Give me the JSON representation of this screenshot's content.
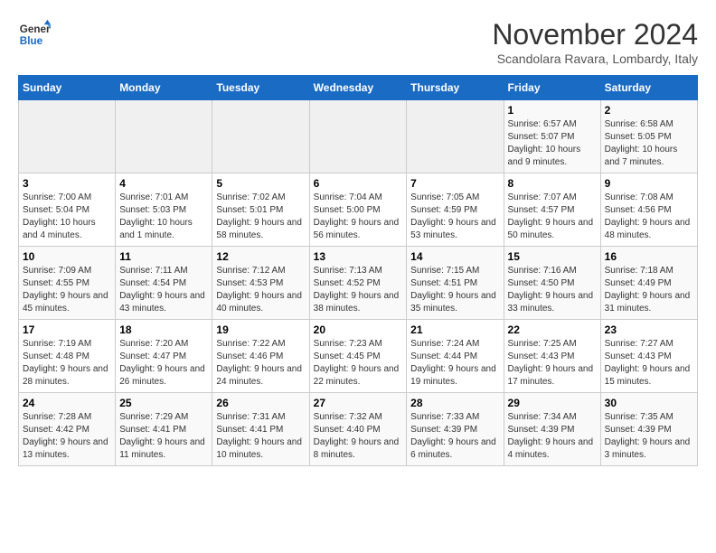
{
  "logo": {
    "line1": "General",
    "line2": "Blue"
  },
  "title": "November 2024",
  "subtitle": "Scandolara Ravara, Lombardy, Italy",
  "days_of_week": [
    "Sunday",
    "Monday",
    "Tuesday",
    "Wednesday",
    "Thursday",
    "Friday",
    "Saturday"
  ],
  "weeks": [
    [
      {
        "day": "",
        "info": ""
      },
      {
        "day": "",
        "info": ""
      },
      {
        "day": "",
        "info": ""
      },
      {
        "day": "",
        "info": ""
      },
      {
        "day": "",
        "info": ""
      },
      {
        "day": "1",
        "info": "Sunrise: 6:57 AM\nSunset: 5:07 PM\nDaylight: 10 hours and 9 minutes."
      },
      {
        "day": "2",
        "info": "Sunrise: 6:58 AM\nSunset: 5:05 PM\nDaylight: 10 hours and 7 minutes."
      }
    ],
    [
      {
        "day": "3",
        "info": "Sunrise: 7:00 AM\nSunset: 5:04 PM\nDaylight: 10 hours and 4 minutes."
      },
      {
        "day": "4",
        "info": "Sunrise: 7:01 AM\nSunset: 5:03 PM\nDaylight: 10 hours and 1 minute."
      },
      {
        "day": "5",
        "info": "Sunrise: 7:02 AM\nSunset: 5:01 PM\nDaylight: 9 hours and 58 minutes."
      },
      {
        "day": "6",
        "info": "Sunrise: 7:04 AM\nSunset: 5:00 PM\nDaylight: 9 hours and 56 minutes."
      },
      {
        "day": "7",
        "info": "Sunrise: 7:05 AM\nSunset: 4:59 PM\nDaylight: 9 hours and 53 minutes."
      },
      {
        "day": "8",
        "info": "Sunrise: 7:07 AM\nSunset: 4:57 PM\nDaylight: 9 hours and 50 minutes."
      },
      {
        "day": "9",
        "info": "Sunrise: 7:08 AM\nSunset: 4:56 PM\nDaylight: 9 hours and 48 minutes."
      }
    ],
    [
      {
        "day": "10",
        "info": "Sunrise: 7:09 AM\nSunset: 4:55 PM\nDaylight: 9 hours and 45 minutes."
      },
      {
        "day": "11",
        "info": "Sunrise: 7:11 AM\nSunset: 4:54 PM\nDaylight: 9 hours and 43 minutes."
      },
      {
        "day": "12",
        "info": "Sunrise: 7:12 AM\nSunset: 4:53 PM\nDaylight: 9 hours and 40 minutes."
      },
      {
        "day": "13",
        "info": "Sunrise: 7:13 AM\nSunset: 4:52 PM\nDaylight: 9 hours and 38 minutes."
      },
      {
        "day": "14",
        "info": "Sunrise: 7:15 AM\nSunset: 4:51 PM\nDaylight: 9 hours and 35 minutes."
      },
      {
        "day": "15",
        "info": "Sunrise: 7:16 AM\nSunset: 4:50 PM\nDaylight: 9 hours and 33 minutes."
      },
      {
        "day": "16",
        "info": "Sunrise: 7:18 AM\nSunset: 4:49 PM\nDaylight: 9 hours and 31 minutes."
      }
    ],
    [
      {
        "day": "17",
        "info": "Sunrise: 7:19 AM\nSunset: 4:48 PM\nDaylight: 9 hours and 28 minutes."
      },
      {
        "day": "18",
        "info": "Sunrise: 7:20 AM\nSunset: 4:47 PM\nDaylight: 9 hours and 26 minutes."
      },
      {
        "day": "19",
        "info": "Sunrise: 7:22 AM\nSunset: 4:46 PM\nDaylight: 9 hours and 24 minutes."
      },
      {
        "day": "20",
        "info": "Sunrise: 7:23 AM\nSunset: 4:45 PM\nDaylight: 9 hours and 22 minutes."
      },
      {
        "day": "21",
        "info": "Sunrise: 7:24 AM\nSunset: 4:44 PM\nDaylight: 9 hours and 19 minutes."
      },
      {
        "day": "22",
        "info": "Sunrise: 7:25 AM\nSunset: 4:43 PM\nDaylight: 9 hours and 17 minutes."
      },
      {
        "day": "23",
        "info": "Sunrise: 7:27 AM\nSunset: 4:43 PM\nDaylight: 9 hours and 15 minutes."
      }
    ],
    [
      {
        "day": "24",
        "info": "Sunrise: 7:28 AM\nSunset: 4:42 PM\nDaylight: 9 hours and 13 minutes."
      },
      {
        "day": "25",
        "info": "Sunrise: 7:29 AM\nSunset: 4:41 PM\nDaylight: 9 hours and 11 minutes."
      },
      {
        "day": "26",
        "info": "Sunrise: 7:31 AM\nSunset: 4:41 PM\nDaylight: 9 hours and 10 minutes."
      },
      {
        "day": "27",
        "info": "Sunrise: 7:32 AM\nSunset: 4:40 PM\nDaylight: 9 hours and 8 minutes."
      },
      {
        "day": "28",
        "info": "Sunrise: 7:33 AM\nSunset: 4:39 PM\nDaylight: 9 hours and 6 minutes."
      },
      {
        "day": "29",
        "info": "Sunrise: 7:34 AM\nSunset: 4:39 PM\nDaylight: 9 hours and 4 minutes."
      },
      {
        "day": "30",
        "info": "Sunrise: 7:35 AM\nSunset: 4:39 PM\nDaylight: 9 hours and 3 minutes."
      }
    ]
  ]
}
